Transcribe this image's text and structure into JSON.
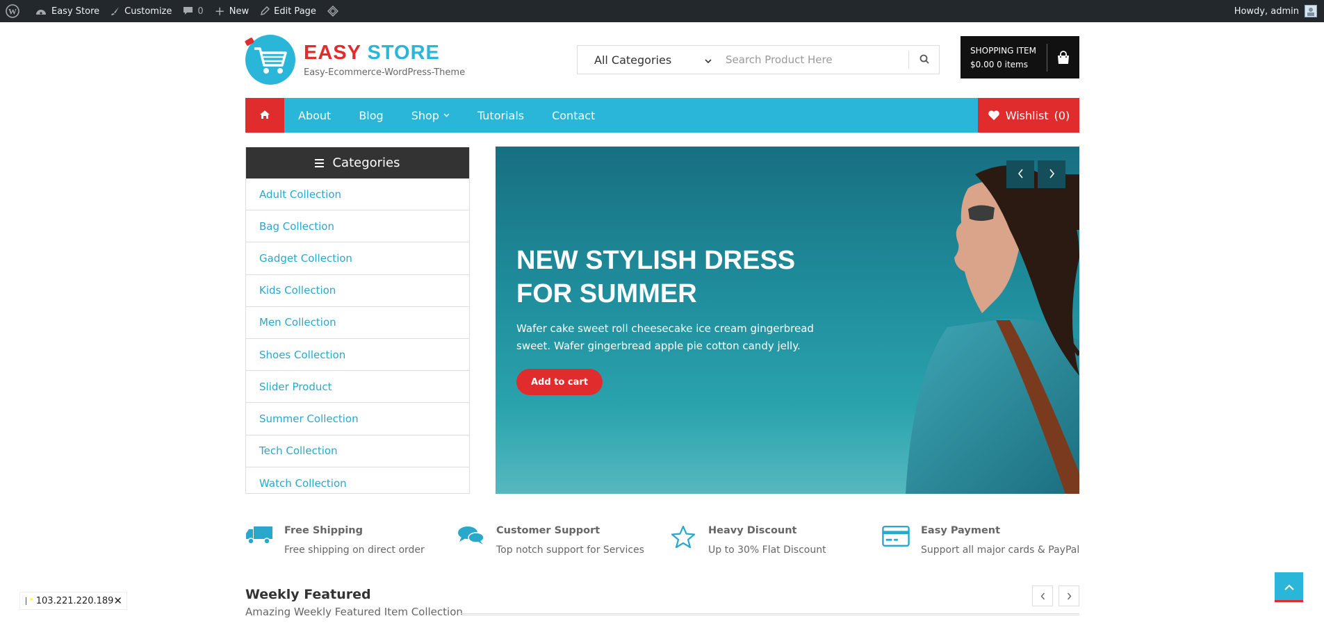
{
  "admin_bar": {
    "site_name": "Easy Store",
    "customize": "Customize",
    "comments_count": "0",
    "new_label": "New",
    "edit_page": "Edit Page",
    "howdy": "Howdy, admin"
  },
  "header": {
    "logo_word1": "EASY",
    "logo_word2": "STORE",
    "tagline": "Easy-Ecommerce-WordPress-Theme",
    "search": {
      "category_selected": "All Categories",
      "placeholder": "Search Product Here"
    },
    "cart": {
      "title": "SHOPPING ITEM",
      "summary": "$0.00 0 items"
    }
  },
  "nav": {
    "items": [
      {
        "label": "About"
      },
      {
        "label": "Blog"
      },
      {
        "label": "Shop"
      },
      {
        "label": "Tutorials"
      },
      {
        "label": "Contact"
      }
    ],
    "wishlist": "Wishlist",
    "wishlist_count": "(0)"
  },
  "categories": {
    "heading": "Categories",
    "items": [
      "Adult Collection",
      "Bag Collection",
      "Gadget Collection",
      "Kids Collection",
      "Men Collection",
      "Shoes Collection",
      "Slider Product",
      "Summer Collection",
      "Tech Collection",
      "Watch Collection"
    ]
  },
  "slider": {
    "title": "NEW STYLISH DRESS FOR SUMMER",
    "description": "Wafer cake sweet roll cheesecake ice cream gingerbread sweet. Wafer gingerbread apple pie cotton candy jelly.",
    "button": "Add to cart"
  },
  "features": [
    {
      "title": "Free Shipping",
      "desc": "Free shipping on direct order",
      "icon": "truck-icon"
    },
    {
      "title": "Customer Support",
      "desc": "Top notch support for Services",
      "icon": "chat-icon"
    },
    {
      "title": "Heavy Discount",
      "desc": "Up to 30% Flat Discount",
      "icon": "star-icon"
    },
    {
      "title": "Easy Payment",
      "desc": "Support all major cards & PayPal",
      "icon": "credit-card-icon"
    }
  ],
  "weekly": {
    "title": "Weekly Featured",
    "subtitle": "Amazing Weekly Featured Item Collection"
  },
  "ip_badge": {
    "ip": "103.221.220.189"
  },
  "colors": {
    "brand_blue": "#29b6d8",
    "brand_red": "#e02c2c",
    "dark": "#333333",
    "admin_bar": "#23282d"
  }
}
